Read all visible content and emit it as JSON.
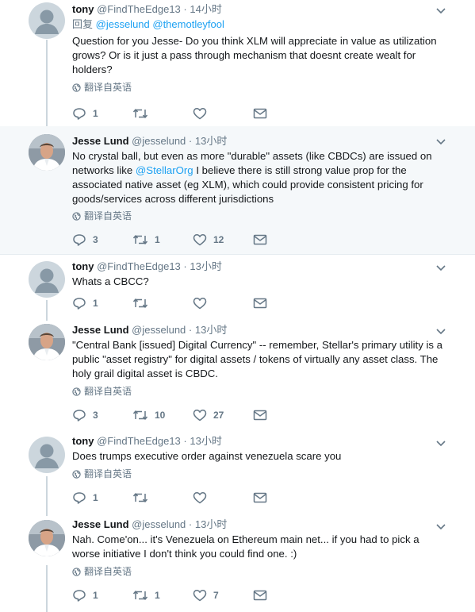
{
  "tweets": [
    {
      "name": "tony",
      "handle": "@FindTheEdge13",
      "dot": "·",
      "time": "14小时",
      "reply_label": "回复",
      "reply_mentions": "@jesselund @themotleyfool",
      "text": "Question for you Jesse- Do you think XLM will appreciate in value as utilization grows? Or is it just a pass through mechanism that doesnt create wealt for holders?",
      "translate": "翻译自英语",
      "counts": {
        "reply": "1",
        "retweet": "",
        "like": ""
      }
    },
    {
      "name": "Jesse Lund",
      "handle": "@jesselund",
      "dot": "·",
      "time": "13小时",
      "text_before": "No crystal ball, but even as more \"durable\" assets (like CBDCs) are issued on networks like ",
      "text_mention": "@StellarOrg",
      "text_after": " I believe there is still strong value prop for the associated native asset (eg XLM), which could provide consistent pricing for goods/services across different jurisdictions",
      "translate": "翻译自英语",
      "counts": {
        "reply": "3",
        "retweet": "1",
        "like": "12"
      }
    },
    {
      "name": "tony",
      "handle": "@FindTheEdge13",
      "dot": "·",
      "time": "13小时",
      "text": "Whats a CBCC?",
      "counts": {
        "reply": "1",
        "retweet": "",
        "like": ""
      }
    },
    {
      "name": "Jesse Lund",
      "handle": "@jesselund",
      "dot": "·",
      "time": "13小时",
      "text": "\"Central Bank [issued] Digital Currency\" -- remember, Stellar's primary utility is a public \"asset registry\" for digital assets / tokens of virtually any asset class.  The holy grail digital asset is CBDC.",
      "translate": "翻译自英语",
      "counts": {
        "reply": "3",
        "retweet": "10",
        "like": "27"
      }
    },
    {
      "name": "tony",
      "handle": "@FindTheEdge13",
      "dot": "·",
      "time": "13小时",
      "text": "Does trumps executive order against venezuela scare you",
      "translate": "翻译自英语",
      "counts": {
        "reply": "1",
        "retweet": "",
        "like": ""
      }
    },
    {
      "name": "Jesse Lund",
      "handle": "@jesselund",
      "dot": "·",
      "time": "13小时",
      "text": "Nah.  Come'on... it's Venezuela on Ethereum main net... if you had to pick a worse initiative I don't think you could find one. :)",
      "translate": "翻译自英语",
      "counts": {
        "reply": "1",
        "retweet": "1",
        "like": "7"
      }
    }
  ],
  "colors": {
    "accent": "#1da1f2",
    "muted": "#657786",
    "highlight_bg": "#f5f8fa",
    "border": "#e6ecf0"
  },
  "icons": [
    "reply-icon",
    "retweet-icon",
    "like-icon",
    "message-icon",
    "globe-icon",
    "caret-down-icon"
  ]
}
